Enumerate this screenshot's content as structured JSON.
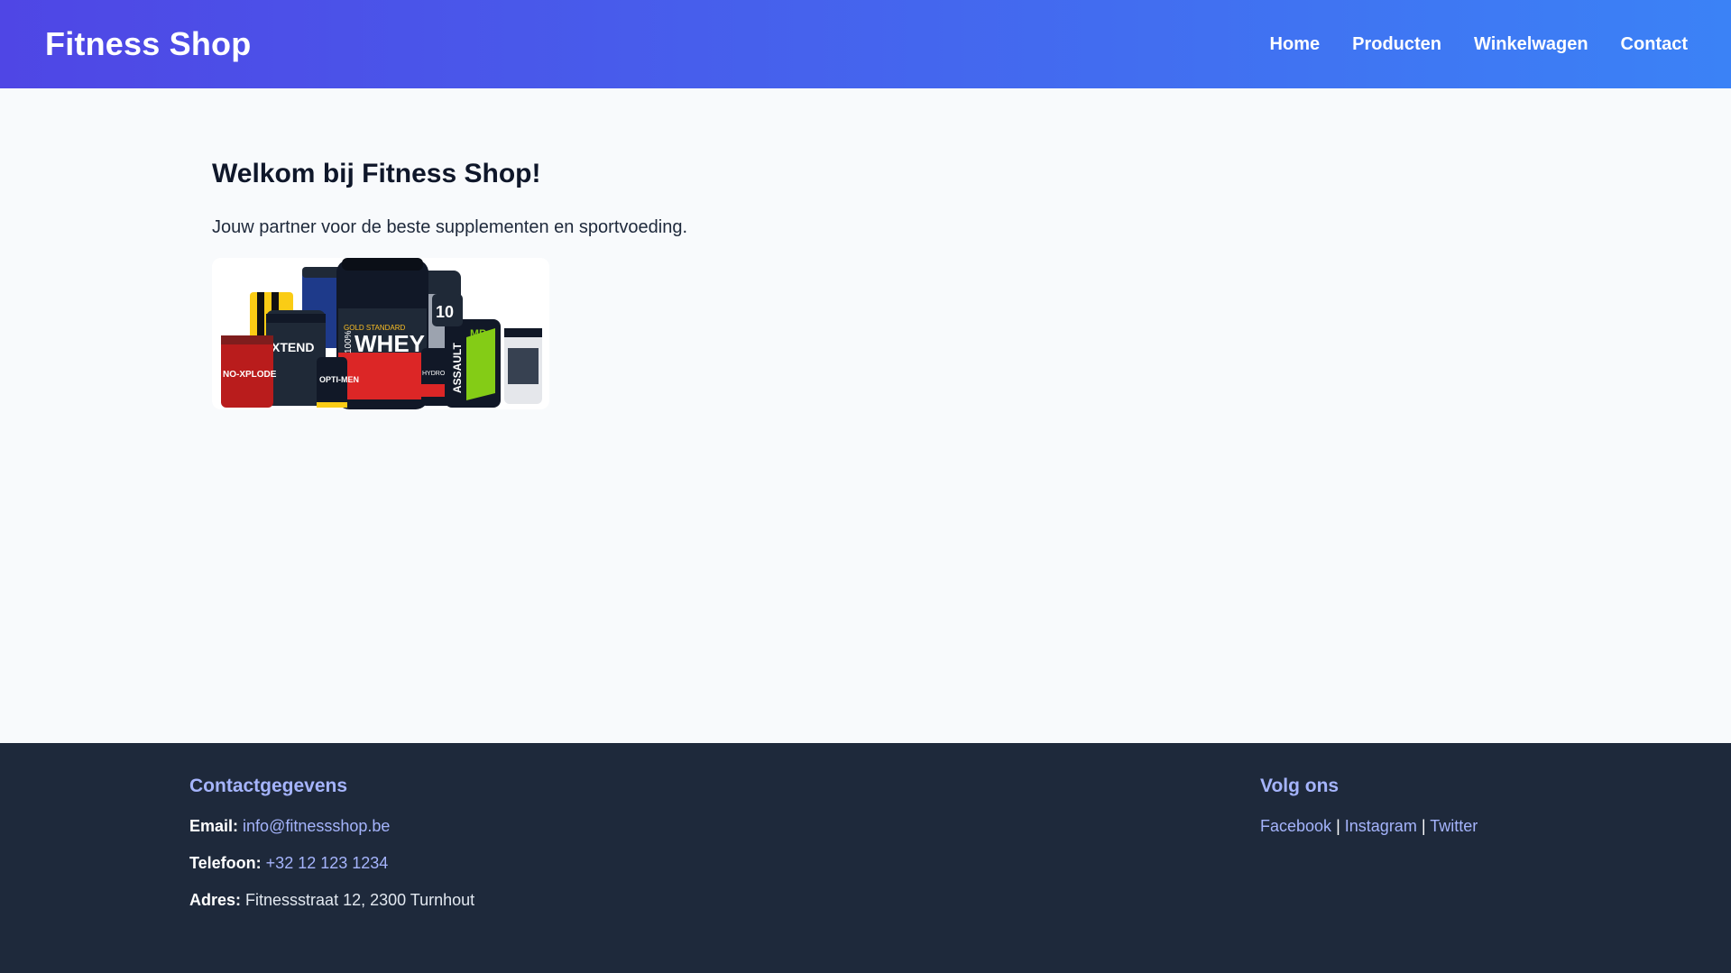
{
  "header": {
    "brand": "Fitness Shop",
    "nav": [
      "Home",
      "Producten",
      "Winkelwagen",
      "Contact"
    ]
  },
  "main": {
    "title": "Welkom bij Fitness Shop!",
    "intro": "Jouw partner voor de beste supplementen en sportvoeding.",
    "image_labels": [
      "GOLD STANDARD",
      "100%",
      "WHEY",
      "XTEND",
      "NO-XPLODE",
      "OPTI-MEN",
      "ASSAULT",
      "HYDROXYCUT",
      "MP",
      "10"
    ]
  },
  "footer": {
    "contact_title": "Contactgegevens",
    "email_label": "Email:",
    "email": "info@fitnessshop.be",
    "phone_label": "Telefoon:",
    "phone": "+32 12 123 1234",
    "address_label": "Adres:",
    "address": "Fitnessstraat 12, 2300 Turnhout",
    "social_title": "Volg ons",
    "social_links": [
      "Facebook",
      "Instagram",
      "Twitter"
    ],
    "social_separator": "|"
  },
  "colors": {
    "header_gradient_start": "#4f46e5",
    "header_gradient_end": "#3b82f6",
    "footer_bg": "#1e293b",
    "link": "#a5b4fc"
  }
}
